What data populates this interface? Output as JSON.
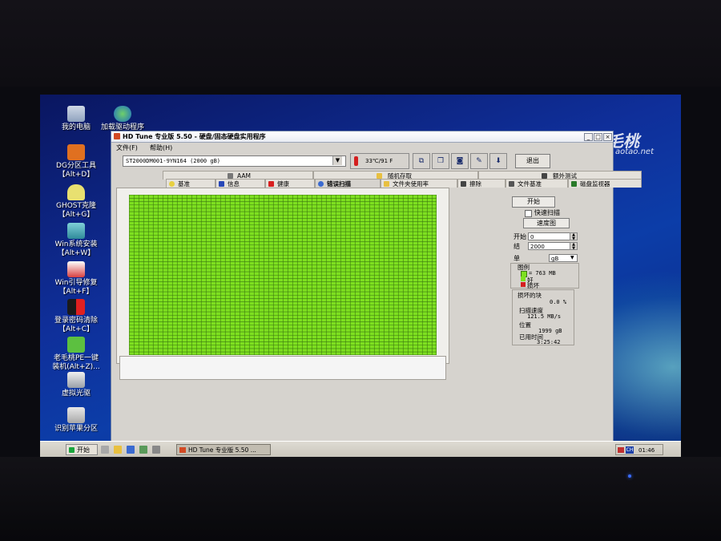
{
  "desktop": {
    "brand_text": "老毛桃",
    "brand_site": "aotao.net",
    "icons": [
      {
        "label": "我的电脑",
        "icon": "computer-icon"
      },
      {
        "label": "加载驱动程序",
        "icon": "globe-icon"
      },
      {
        "label": "DG分区工具",
        "label2": "【Alt+D】",
        "icon": "partition-tool-icon"
      },
      {
        "label": "GHOST克隆",
        "label2": "【Alt+G】",
        "icon": "ghost-icon"
      },
      {
        "label": "Win系统安装",
        "label2": "【Alt+W】",
        "icon": "installer-icon"
      },
      {
        "label": "Win引导修复",
        "label2": "【Alt+F】",
        "icon": "boot-repair-icon"
      },
      {
        "label": "登录密码清除",
        "label2": "【Alt+C】",
        "icon": "password-clear-icon"
      },
      {
        "label": "老毛桃PE一键",
        "label2": "装机(Alt+Z)...",
        "icon": "one-click-install-icon"
      },
      {
        "label": "虚拟光驱",
        "icon": "virtual-drive-icon"
      },
      {
        "label": "识别苹果分区",
        "icon": "apple-partition-icon"
      }
    ]
  },
  "window": {
    "title": "HD Tune 专业版 5.50 - 硬盘/固态硬盘实用程序",
    "controls": {
      "minimize": "_",
      "maximize": "□",
      "close": "×"
    },
    "menu": [
      "文件(F)",
      "帮助(H)"
    ],
    "drive": "ST2000DM001-9YN164 (2000 gB)",
    "temperature": "33℃/91 F",
    "exit_label": "退出",
    "tabs_top": [
      {
        "label": "AAM",
        "icon": "speaker-icon"
      },
      {
        "label": "随机存取",
        "icon": "random-access-icon"
      },
      {
        "label": "额外测试",
        "icon": "extra-tests-icon"
      }
    ],
    "tabs_bottom": [
      {
        "label": "基准",
        "icon": "benchmark-icon"
      },
      {
        "label": "信息",
        "icon": "info-icon"
      },
      {
        "label": "健康",
        "icon": "health-icon"
      },
      {
        "label": "错误扫描",
        "icon": "error-scan-icon"
      },
      {
        "label": "文件夹使用率",
        "icon": "folder-usage-icon"
      },
      {
        "label": "擦除",
        "icon": "erase-icon"
      },
      {
        "label": "文件基准",
        "icon": "file-benchmark-icon"
      },
      {
        "label": "磁盘监视器",
        "icon": "disk-monitor-icon"
      }
    ],
    "active_tab": "错误扫描",
    "scan": {
      "rows": 48,
      "cols": 64,
      "block_color": "#7ee020",
      "grid_color": "#3c7a10"
    },
    "panel": {
      "start_label": "开始",
      "quick_scan_label": "快速扫描",
      "speed_label": "速度图",
      "start_field_label": "开始",
      "start_value": "0",
      "end_field_label": "结",
      "end_value": "2000",
      "unit_label": "单",
      "unit_value": "gB",
      "legend_title": "图例",
      "legend_block": "= 763 MB",
      "legend_good": "好",
      "legend_bad": "损坏",
      "good_color": "#7ee020",
      "bad_color": "#d42020",
      "bad_blocks_label": "损坏的块",
      "bad_blocks_value": "0.0 %",
      "scan_speed_label": "扫描速度",
      "scan_speed_value": "121.5 MB/s",
      "position_label": "位置",
      "position_value": "1999 gB",
      "elapsed_label": "已用时间",
      "elapsed_value": "3:25:42"
    }
  },
  "taskbar": {
    "start_label": "开始",
    "task_label": "HD Tune 专业版 5.50 ...",
    "tray_ime": "CH",
    "time": "01:46"
  }
}
